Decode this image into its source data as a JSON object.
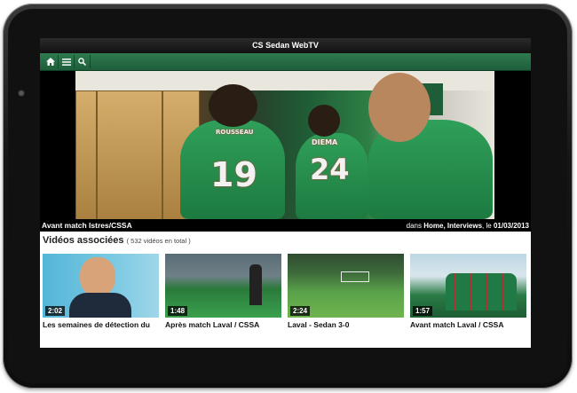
{
  "app": {
    "title": "CS Sedan WebTV"
  },
  "toolbar": {
    "home_icon": "home-icon",
    "menu_icon": "menu-icon",
    "search_icon": "search-icon"
  },
  "video": {
    "title": "Avant match Istres/CSSA",
    "meta_prefix": "dans",
    "categories": "Home, Interviews",
    "meta_date_prefix": ", le",
    "date": "01/03/2013",
    "jersey_numbers": [
      "19",
      "24"
    ],
    "jersey_names": [
      "ROUSSEAU",
      "DIEMA"
    ]
  },
  "related": {
    "heading": "Vidéos associées",
    "count": "( 532 vidéos en total )",
    "items": [
      {
        "duration": "2:02",
        "title": "Les semaines de détection du"
      },
      {
        "duration": "1:48",
        "title": "Après match Laval / CSSA"
      },
      {
        "duration": "2:24",
        "title": "Laval - Sedan 3-0"
      },
      {
        "duration": "1:57",
        "title": "Avant match Laval / CSSA"
      }
    ]
  },
  "colors": {
    "toolbar_green": "#2a6e46",
    "titlebar_bg": "#1a1a1a"
  }
}
